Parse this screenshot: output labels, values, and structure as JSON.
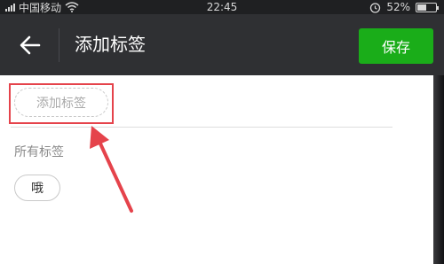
{
  "status_bar": {
    "carrier": "中国移动",
    "time": "22:45",
    "battery": "52%",
    "battery_level": 0.52,
    "icons": [
      "signal-icon",
      "wifi-icon",
      "alarm-icon",
      "battery-icon"
    ]
  },
  "nav": {
    "back_icon": "back-arrow-icon",
    "title": "添加标签",
    "save_label": "保存"
  },
  "content": {
    "tag_input_placeholder": "添加标签",
    "section_label": "所有标签",
    "tags": [
      "哦"
    ]
  },
  "colors": {
    "nav_background": "#2f3033",
    "save_button": "#1aad19",
    "annotation_red": "#e5434b"
  }
}
